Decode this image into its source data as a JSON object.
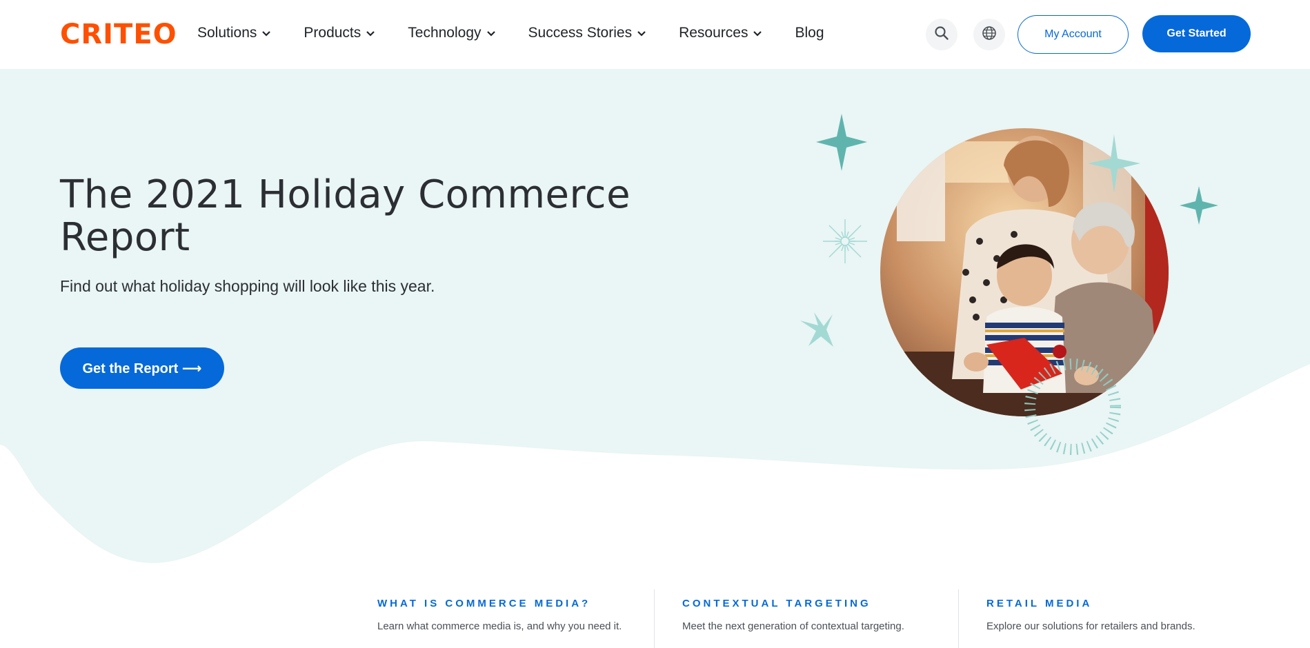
{
  "header": {
    "logo": "CRITEO",
    "nav": [
      {
        "label": "Solutions",
        "has_dropdown": true
      },
      {
        "label": "Products",
        "has_dropdown": true
      },
      {
        "label": "Technology",
        "has_dropdown": true
      },
      {
        "label": "Success Stories",
        "has_dropdown": true
      },
      {
        "label": "Resources",
        "has_dropdown": true
      },
      {
        "label": "Blog",
        "has_dropdown": false
      }
    ],
    "search_icon": "search-icon",
    "language_icon": "globe-icon",
    "account_label": "My Account",
    "get_started_label": "Get Started"
  },
  "hero": {
    "title": "The 2021 Holiday Commerce Report",
    "subtitle": "Find out what holiday shopping will look like this year.",
    "cta_label": "Get the Report ⟶"
  },
  "cards": [
    {
      "title": "WHAT IS COMMERCE MEDIA?",
      "description": "Learn what commerce media is, and why you need it."
    },
    {
      "title": "CONTEXTUAL TARGETING",
      "description": "Meet the next generation of contextual targeting."
    },
    {
      "title": "RETAIL MEDIA",
      "description": "Explore our solutions for retailers and brands."
    }
  ],
  "colors": {
    "brand_orange": "#fe5000",
    "primary_blue": "#0569d9",
    "hero_bg": "#eaf5f5",
    "teal_accent": "#5fb5ad",
    "light_teal": "#a3d9d3"
  }
}
